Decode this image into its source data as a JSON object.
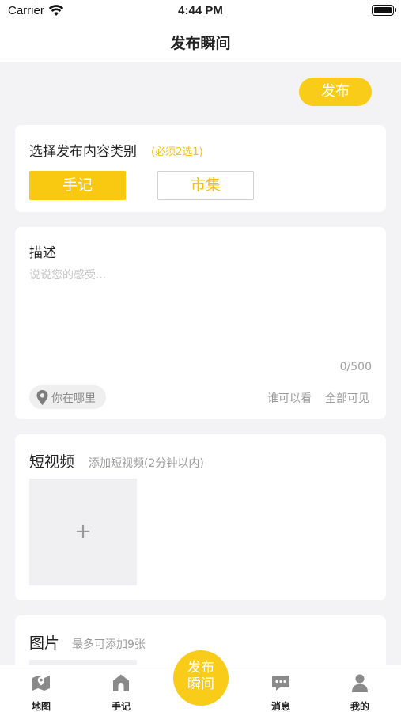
{
  "status_bar": {
    "carrier": "Carrier",
    "time": "4:44 PM"
  },
  "nav": {
    "title": "发布瞬间"
  },
  "publish_button": "发布",
  "category": {
    "title": "选择发布内容类别",
    "hint": "(必须2选1)",
    "options": [
      "手记",
      "市集"
    ],
    "selected": "手记"
  },
  "description": {
    "title": "描述",
    "placeholder": "说说您的感受...",
    "counter": "0/500",
    "location": "你在哪里",
    "visibility_label": "谁可以看",
    "visibility_value": "全部可见"
  },
  "video": {
    "title": "短视频",
    "hint": "添加短视频(2分钟以内)",
    "add_symbol": "+"
  },
  "images": {
    "title": "图片",
    "hint": "最多可添加9张"
  },
  "tabs": [
    {
      "label": "地图",
      "icon": "map-icon"
    },
    {
      "label": "手记",
      "icon": "home-icon"
    },
    {
      "label": "发布瞬间",
      "icon": "publish-center"
    },
    {
      "label": "消息",
      "icon": "message-icon"
    },
    {
      "label": "我的",
      "icon": "user-icon"
    }
  ],
  "colors": {
    "accent": "#F9CC1A",
    "background": "#F3F3F5",
    "card": "#FFFFFF"
  }
}
